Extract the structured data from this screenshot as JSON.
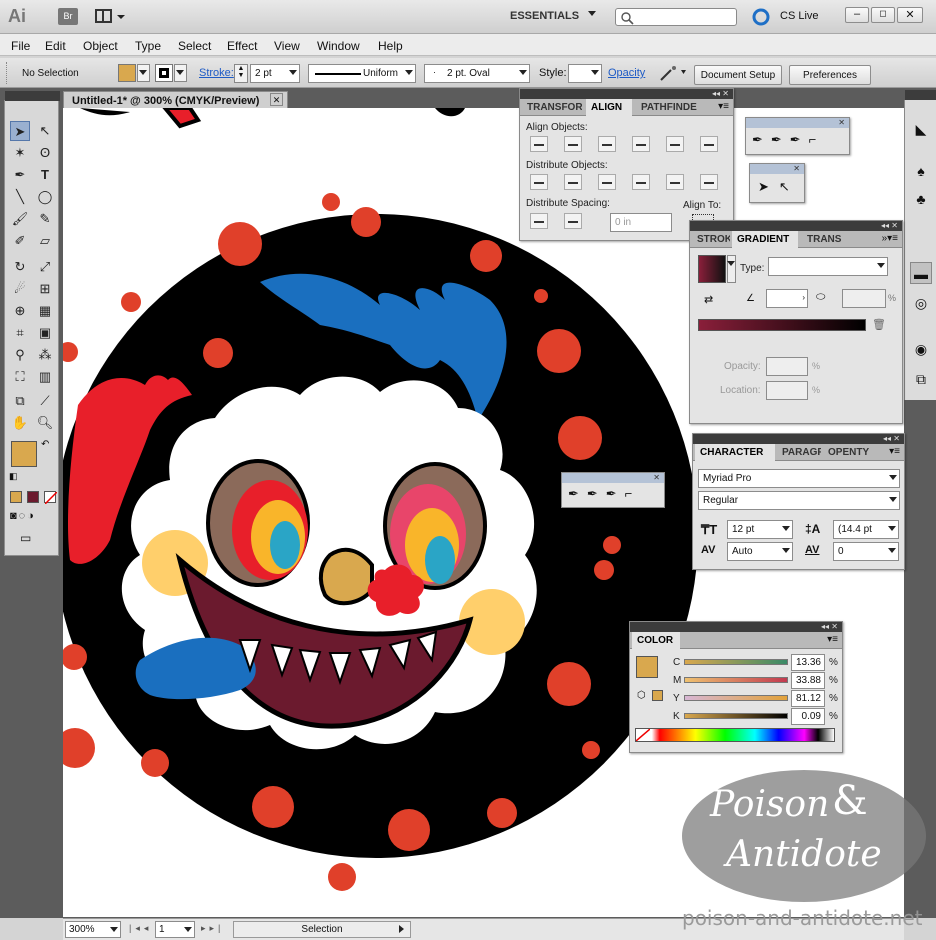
{
  "app": {
    "logo": "Ai",
    "bridge": "Br",
    "workspace": "ESSENTIALS",
    "search_placeholder": "",
    "cslive": "CS Live"
  },
  "menu": [
    "File",
    "Edit",
    "Object",
    "Type",
    "Select",
    "Effect",
    "View",
    "Window",
    "Help"
  ],
  "control": {
    "selection": "No Selection",
    "stroke_label": "Stroke:",
    "stroke_weight": "2 pt",
    "stroke_profile": "Uniform",
    "brush": "2 pt. Oval",
    "style_label": "Style:",
    "opacity_label": "Opacity",
    "doc_setup": "Document Setup",
    "preferences": "Preferences"
  },
  "doc_tab": "Untitled-1* @ 300% (CMYK/Preview)",
  "align_panel": {
    "tabs": [
      "TRANSFOR",
      "ALIGN",
      "PATHFINDE"
    ],
    "align_objects": "Align Objects:",
    "distribute_objects": "Distribute Objects:",
    "distribute_spacing": "Distribute Spacing:",
    "align_to": "Align To:",
    "spacing_value": "0 in"
  },
  "gradient_panel": {
    "tabs": [
      "STROK",
      "GRADIENT",
      "TRANS"
    ],
    "type_label": "Type:",
    "opacity_label": "Opacity:",
    "location_label": "Location:",
    "pct1": "%",
    "pct2": "%",
    "pct3": "%"
  },
  "character_panel": {
    "tabs": [
      "CHARACTER",
      "PARAGR",
      "OPENTY"
    ],
    "font": "Myriad Pro",
    "style": "Regular",
    "size": "12 pt",
    "leading": "(14.4 pt",
    "kerning": "Auto",
    "tracking": "0"
  },
  "color_panel": {
    "tab": "COLOR",
    "channels": [
      {
        "name": "C",
        "value": "13.36",
        "unit": "%"
      },
      {
        "name": "M",
        "value": "33.88",
        "unit": "%"
      },
      {
        "name": "Y",
        "value": "81.12",
        "unit": "%"
      },
      {
        "name": "K",
        "value": "0.09",
        "unit": "%"
      }
    ]
  },
  "status": {
    "zoom": "300%",
    "page": "1",
    "tool": "Selection"
  },
  "watermark": {
    "line1": "Poison",
    "amp": "&",
    "line2": "Antidote",
    "url": "poison-and-antidote.net"
  },
  "colors": {
    "fill": "#d9a84e",
    "red_dot": "#e0402a",
    "blue": "#1a6fbf",
    "red": "#e81f2a",
    "cream": "#ffcf6b"
  }
}
